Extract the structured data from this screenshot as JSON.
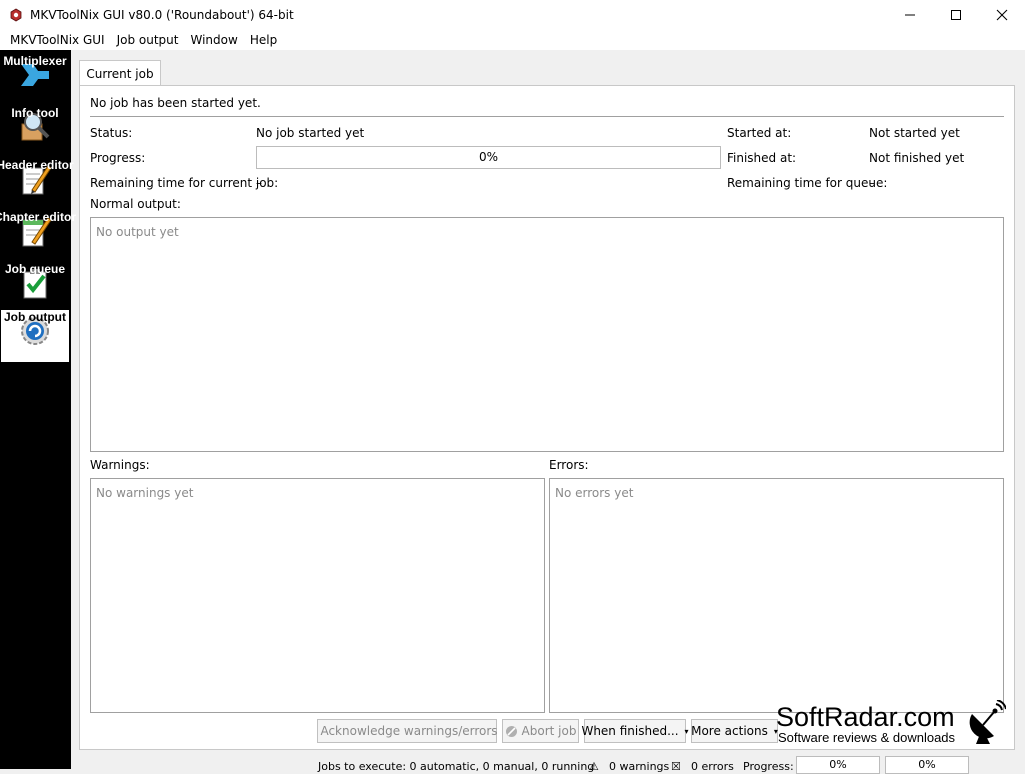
{
  "window": {
    "title": "MKVToolNix GUI v80.0 ('Roundabout') 64-bit"
  },
  "menu": [
    "MKVToolNix GUI",
    "Job output",
    "Window",
    "Help"
  ],
  "sidebar": {
    "items": [
      {
        "label": "Multiplexer",
        "icon": "multiplexer-icon"
      },
      {
        "label": "Info tool",
        "icon": "info-tool-icon"
      },
      {
        "label": "Header editor",
        "icon": "header-editor-icon"
      },
      {
        "label": "Chapter editor",
        "icon": "chapter-editor-icon"
      },
      {
        "label": "Job queue",
        "icon": "job-queue-icon"
      },
      {
        "label": "Job output",
        "icon": "job-output-icon",
        "active": true
      }
    ]
  },
  "tabs": [
    {
      "label": "Current job",
      "active": true
    }
  ],
  "job": {
    "header": "No job has been started yet.",
    "status_label": "Status:",
    "status_value": "No job started yet",
    "progress_label": "Progress:",
    "progress_text": "0%",
    "progress_fraction": 0,
    "remaining_current_label": "Remaining time for current job:",
    "remaining_current_value": "–",
    "started_label": "Started at:",
    "started_value": "Not started yet",
    "finished_label": "Finished at:",
    "finished_value": "Not finished yet",
    "remaining_queue_label": "Remaining time for queue:",
    "remaining_queue_value": "–",
    "normal_output_label": "Normal output:",
    "normal_output_placeholder": "No output yet",
    "warnings_label": "Warnings:",
    "warnings_placeholder": "No warnings yet",
    "errors_label": "Errors:",
    "errors_placeholder": "No errors yet"
  },
  "buttons": {
    "acknowledge": "Acknowledge warnings/errors",
    "abort": "Abort job",
    "when_finished": "When finished...",
    "more_actions": "More actions"
  },
  "statusbar": {
    "jobs_text": "Jobs to execute:  0 automatic, 0 manual, 0 running",
    "warnings_text": "0 warnings",
    "errors_text": "0 errors",
    "progress_label": "Progress:",
    "progress_1": "0%",
    "progress_2": "0%"
  },
  "watermark": {
    "title": "SoftRadar.com",
    "subtitle": "Software reviews & downloads"
  }
}
